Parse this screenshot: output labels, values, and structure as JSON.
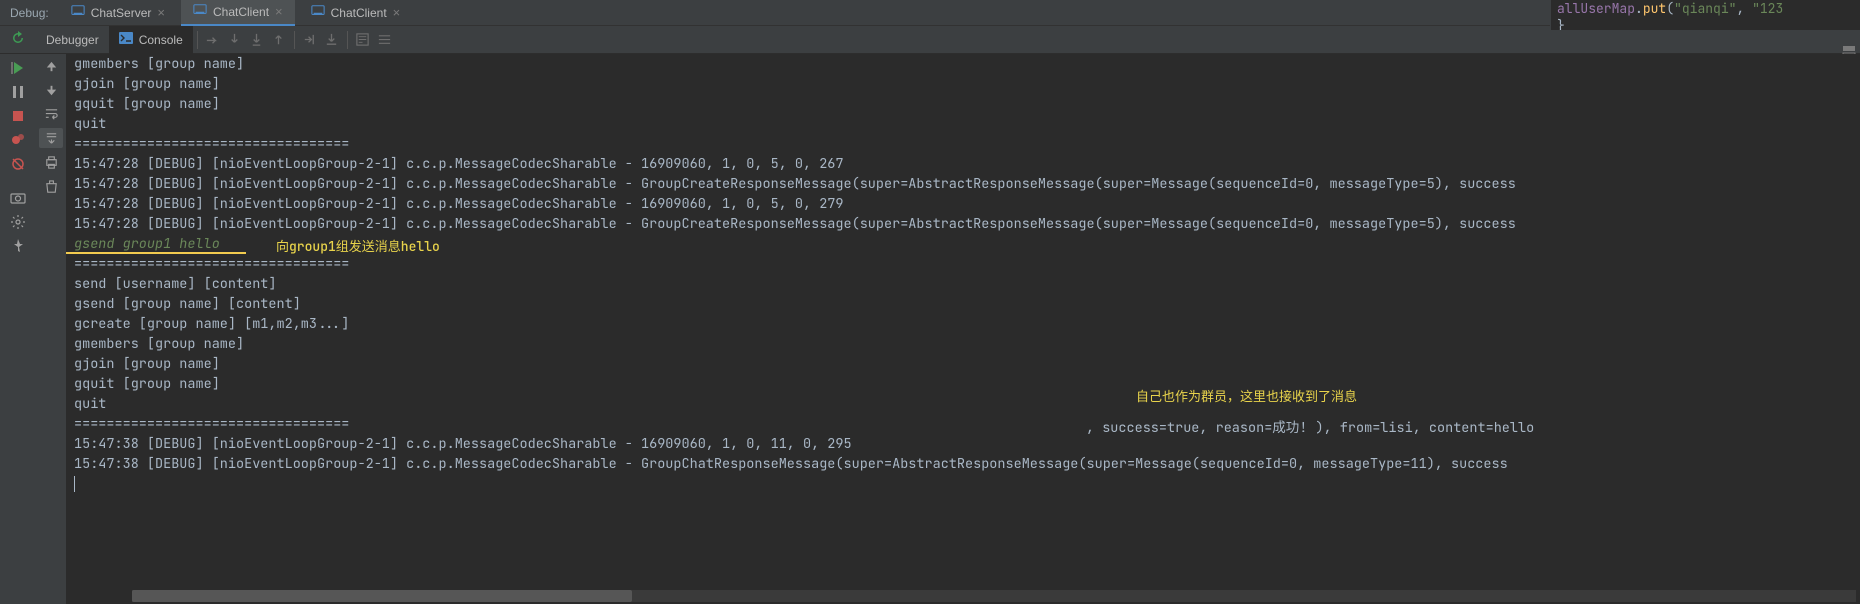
{
  "topbar": {
    "label": "Debug:",
    "tabs": [
      {
        "name": "ChatServer",
        "active": false
      },
      {
        "name": "ChatClient",
        "active": true
      },
      {
        "name": "ChatClient",
        "active": false
      }
    ]
  },
  "subtabs": {
    "debugger": "Debugger",
    "console": "Console"
  },
  "annotations": {
    "note1": "向group1组发送消息hello",
    "note2": "自己也作为群员，这里也接收到了消息"
  },
  "code_snippet": {
    "obj": "allUserMap",
    "method": "put",
    "arg1": "\"qianqi\"",
    "arg2": "\"123"
  },
  "console": {
    "prelude": [
      "gmembers [group name]",
      "gjoin [group name]",
      "gquit [group name]",
      "quit",
      "==================================",
      "15:47:28 [DEBUG] [nioEventLoopGroup-2-1] c.c.p.MessageCodecSharable - 16909060, 1, 0, 5, 0, 267",
      "15:47:28 [DEBUG] [nioEventLoopGroup-2-1] c.c.p.MessageCodecSharable - GroupCreateResponseMessage(super=AbstractResponseMessage(super=Message(sequenceId=0, messageType=5), success",
      "15:47:28 [DEBUG] [nioEventLoopGroup-2-1] c.c.p.MessageCodecSharable - 16909060, 1, 0, 5, 0, 279",
      "15:47:28 [DEBUG] [nioEventLoopGroup-2-1] c.c.p.MessageCodecSharable - GroupCreateResponseMessage(super=AbstractResponseMessage(super=Message(sequenceId=0, messageType=5), success"
    ],
    "input_line": "gsend group1 hello",
    "after": [
      "==================================",
      "send [username] [content]",
      "gsend [group name] [content]",
      "gcreate [group name] [m1,m2,m3...]",
      "gmembers [group name]",
      "gjoin [group name]",
      "gquit [group name]",
      "quit",
      "",
      "==================================",
      "15:47:38 [DEBUG] [nioEventLoopGroup-2-1] c.c.p.MessageCodecSharable - 16909060, 1, 0, 11, 0, 295",
      "15:47:38 [DEBUG] [nioEventLoopGroup-2-1] c.c.p.MessageCodecSharable - GroupChatResponseMessage(super=AbstractResponseMessage(super=Message(sequenceId=0, messageType=11), success"
    ],
    "floating_fragment": ", success=true, reason=成功! ), from=lisi, content=hello"
  }
}
